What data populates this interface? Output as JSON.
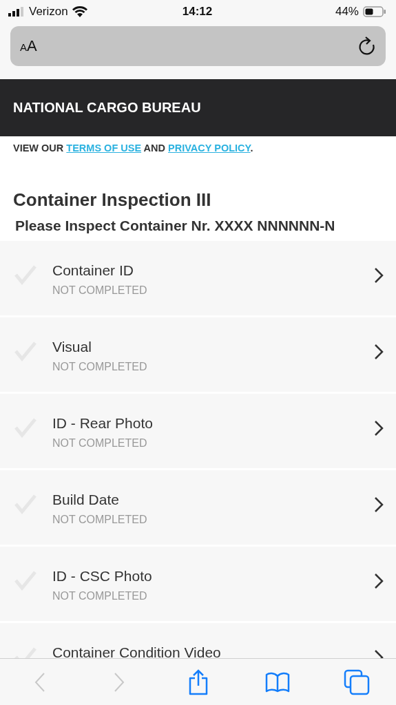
{
  "status_bar": {
    "carrier": "Verizon",
    "time": "14:12",
    "battery": "44%"
  },
  "address_bar": {
    "text_size_button": "AA"
  },
  "header": {
    "title": "NATIONAL CARGO BUREAU"
  },
  "legal": {
    "prefix": "VIEW OUR",
    "link_1": "TERMS OF USE",
    "middle": "AND",
    "link_2": "PRIVACY POLICY",
    "suffix": "."
  },
  "page": {
    "title": "Container Inspection III",
    "subtitle": "Please Inspect Container Nr. XXXX NNNNNN-N"
  },
  "checklist": [
    {
      "label": "Container ID",
      "status": "NOT COMPLETED",
      "checked": false
    },
    {
      "label": "Visual",
      "status": "NOT COMPLETED",
      "checked": false
    },
    {
      "label": "ID - Rear Photo",
      "status": "NOT COMPLETED",
      "checked": false
    },
    {
      "label": "Build Date",
      "status": "NOT COMPLETED",
      "checked": false
    },
    {
      "label": "ID - CSC Photo",
      "status": "NOT COMPLETED",
      "checked": false
    },
    {
      "label": "Container Condition Video",
      "checked": false
    }
  ],
  "toolbar": {
    "back_disabled": true,
    "forward_disabled": true
  }
}
